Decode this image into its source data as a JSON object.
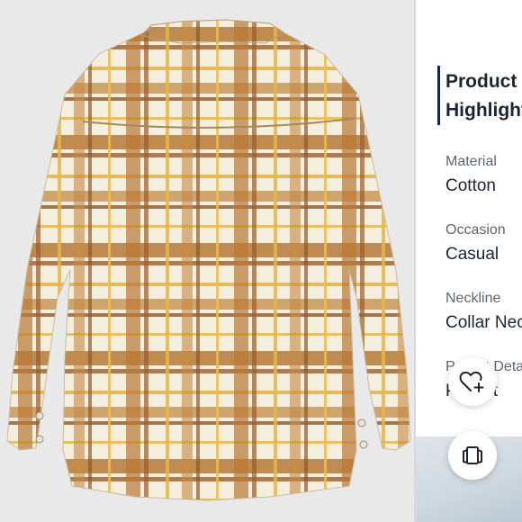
{
  "product_image": {
    "alt_description_icon": "plaid-flannel-shirt-back-view"
  },
  "highlights": {
    "title_line1": "Product",
    "title_line2": "Highlights",
    "items": [
      {
        "label": "Material",
        "value": "Cotton"
      },
      {
        "label": "Occasion",
        "value": "Casual"
      },
      {
        "label": "Neckline",
        "value": "Collar Neck"
      },
      {
        "label": "Pocket Details",
        "value": "Pocket"
      }
    ]
  },
  "actions": {
    "wishlist_icon": "heart-plus-icon",
    "compare_icon": "compare-icon"
  },
  "colors": {
    "accent": "#16254c",
    "text_primary": "#1c2433",
    "text_secondary": "#5f6570"
  }
}
